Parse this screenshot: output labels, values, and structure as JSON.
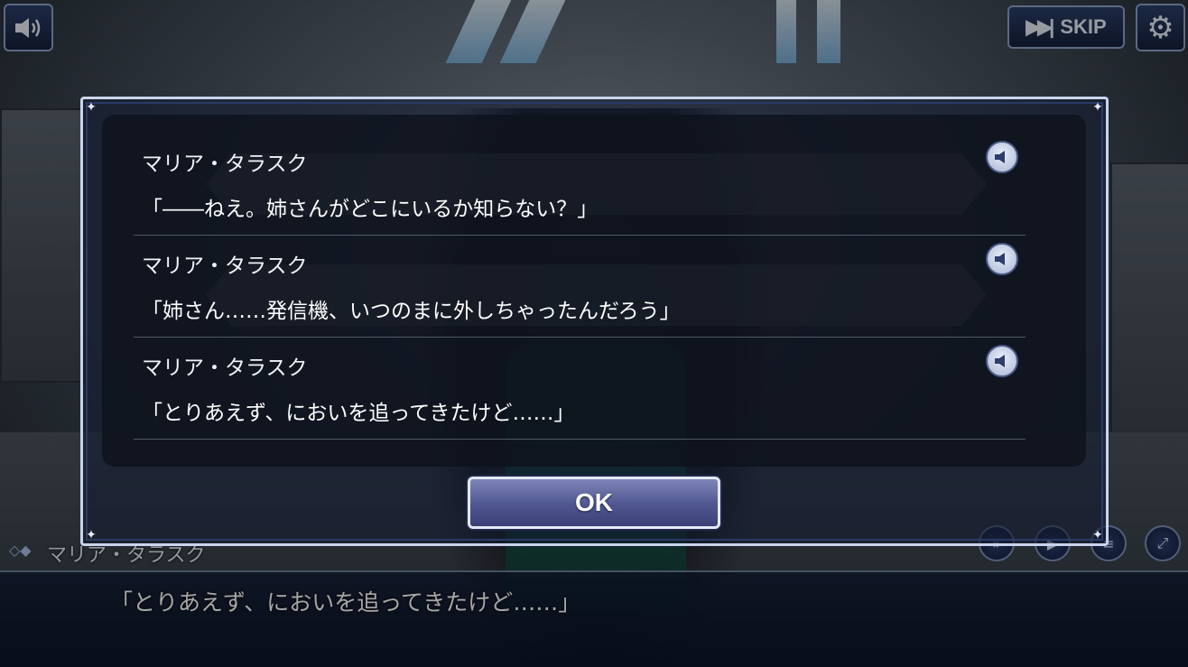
{
  "topbar": {
    "sound_icon": "speaker-icon",
    "skip_label": "SKIP",
    "skip_icon": "fast-forward-icon",
    "settings_icon": "gear-icon"
  },
  "backlog": {
    "entries": [
      {
        "speaker": "マリア・タラスク",
        "text": "「――ねえ。姉さんがどこにいるか知らない？」",
        "voice_icon": "speaker-icon"
      },
      {
        "speaker": "マリア・タラスク",
        "text": "「姉さん……発信機、いつのまに外しちゃったんだろう」",
        "voice_icon": "speaker-icon"
      },
      {
        "speaker": "マリア・タラスク",
        "text": "「とりあえず、においを追ってきたけど……」",
        "voice_icon": "speaker-icon"
      }
    ],
    "ok_label": "OK"
  },
  "message_window": {
    "speaker": "マリア・タラスク",
    "text": "「とりあえず、においを追ってきたけど……」"
  },
  "colors": {
    "dialog_border": "#c9d4ec",
    "ok_button": "#4f5690",
    "voice_button": "#a9b6d3"
  }
}
